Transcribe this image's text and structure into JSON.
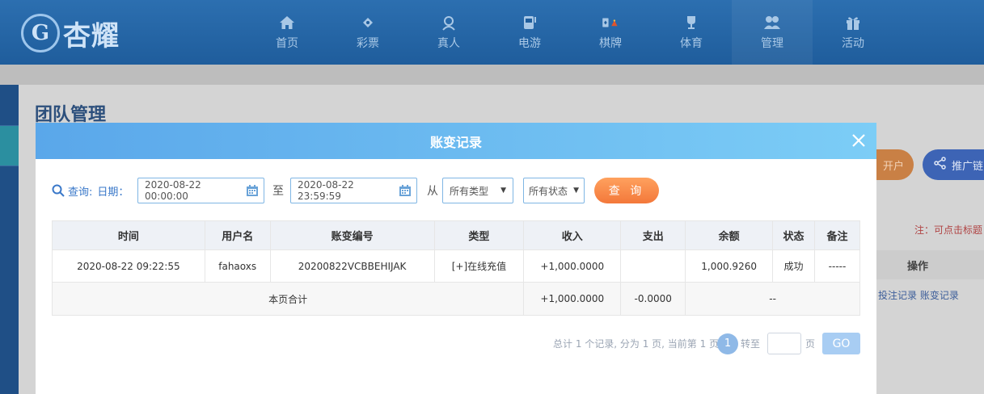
{
  "header": {
    "logo_text": "杏耀",
    "logo_mark": "G",
    "nav": [
      {
        "label": "首页",
        "icon": "home-icon"
      },
      {
        "label": "彩票",
        "icon": "lottery-ticket-icon"
      },
      {
        "label": "真人",
        "icon": "live-dealer-icon"
      },
      {
        "label": "电游",
        "icon": "slot-machine-icon"
      },
      {
        "label": "棋牌",
        "icon": "playing-card-icon"
      },
      {
        "label": "体育",
        "icon": "trophy-icon"
      },
      {
        "label": "管理",
        "icon": "users-icon"
      },
      {
        "label": "活动",
        "icon": "gift-icon"
      }
    ]
  },
  "background_page": {
    "title": "团队管理",
    "open_account_btn": "开户",
    "promo_link_btn": "推广链",
    "note": "注：可点击标题",
    "ops_header": "操作",
    "link_bet_record": "投注记录",
    "link_account_record": "账变记录"
  },
  "modal": {
    "title": "账变记录",
    "filter": {
      "query_label": "查询:",
      "date_label": "日期：",
      "start_date": "2020-08-22 00:00:00",
      "to_label": "至",
      "end_date": "2020-08-22 23:59:59",
      "from_label": "从",
      "type_select": "所有类型",
      "status_select": "所有状态",
      "query_button": "查 询"
    },
    "table": {
      "headers": {
        "time": "时间",
        "username": "用户名",
        "serial": "账变编号",
        "type": "类型",
        "income": "收入",
        "expense": "支出",
        "balance": "余额",
        "status": "状态",
        "remark": "备注"
      },
      "rows": [
        {
          "time": "2020-08-22 09:22:55",
          "username": "fahaoxs",
          "serial": "20200822VCBBEHIJAK",
          "type": "[+]在线充值",
          "income": "+1,000.0000",
          "expense": "",
          "balance": "1,000.9260",
          "status": "成功",
          "remark": "-----"
        }
      ],
      "summary": {
        "label": "本页合计",
        "income": "+1,000.0000",
        "expense": "-0.0000",
        "rest": "--"
      }
    },
    "pager": {
      "summary_text": "总计 1 个记录, 分为 1 页, 当前第 1 页",
      "current_page": "1",
      "goto_label": "转至",
      "page_unit": "页",
      "go_button": "GO"
    }
  }
}
